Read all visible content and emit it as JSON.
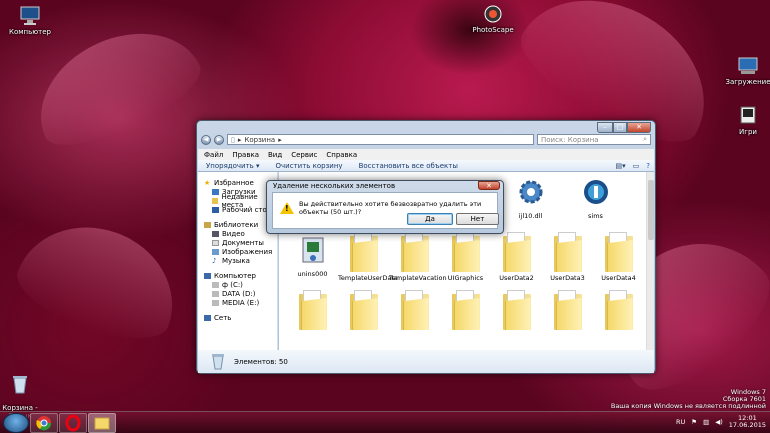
{
  "desktop": {
    "icons": [
      {
        "label": "Компьютер",
        "icon": "computer-icon"
      },
      {
        "label": "PhotoScape",
        "icon": "photoscape-icon"
      },
      {
        "label": "Загружение",
        "icon": "download-icon"
      },
      {
        "label": "Игри",
        "icon": "games-icon"
      },
      {
        "label": "Корзина -\nЯрлык",
        "icon": "recycle-bin-icon"
      }
    ]
  },
  "explorer": {
    "address": "Корзина",
    "search_placeholder": "Поиск: Корзина",
    "menu": [
      "Файл",
      "Правка",
      "Вид",
      "Сервис",
      "Справка"
    ],
    "commands": [
      "Упорядочить ▾",
      "Очистить корзину",
      "Восстановить все объекты"
    ],
    "nav": {
      "favorites": {
        "label": "Избранное",
        "items": [
          "Загрузки",
          "Недавние места",
          "Рабочий стол"
        ]
      },
      "libraries": {
        "label": "Библиотеки",
        "items": [
          "Видео",
          "Документы",
          "Изображения",
          "Музыка"
        ]
      },
      "computer": {
        "label": "Компьютер",
        "items": [
          "ф (C:)",
          "DATA (D:)",
          "MEDIA (E:)"
        ]
      },
      "network": {
        "label": "Сеть"
      }
    },
    "top_items": [
      "ijl10.dll",
      "sims",
      "unins000"
    ],
    "items": [
      "unins000",
      "TemplateUserData",
      "TemplateVacation",
      "UIGraphics",
      "UserData2",
      "UserData3",
      "UserData4"
    ],
    "status": "Элементов: 50"
  },
  "dialog": {
    "title": "Удаление нескольких элементов",
    "message": "Вы действительно хотите безвозвратно удалить эти объекты (50 шт.)?",
    "yes": "Да",
    "no": "Нет"
  },
  "system": {
    "os_name": "Windows 7",
    "build": "Сборка 7601",
    "notice": "Ваша копия Windows не является подлинной",
    "lang": "RU",
    "time": "12:01",
    "date": "17.06.2015"
  },
  "colors": {
    "accent": "#1a3d6e",
    "wallpaper": "#b81a4f",
    "folder": "#f5d86a"
  }
}
